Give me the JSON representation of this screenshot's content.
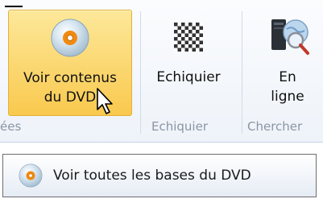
{
  "ribbon": {
    "buttons": [
      {
        "line1": "Voir contenus",
        "line2": "du DVD",
        "icon": "dvd-disc-icon",
        "state": "hovered"
      },
      {
        "line1": "Echiquier",
        "line2": "",
        "icon": "chessboard-icon"
      },
      {
        "line1": "En",
        "line2": "ligne",
        "icon": "online-search-icon"
      }
    ],
    "groups": {
      "left_partial": "ées",
      "echiquier": "Echiquier",
      "chercher": "Chercher"
    }
  },
  "tooltip": {
    "text": "Voir toutes les bases du DVD",
    "icon": "dvd-disc-icon"
  },
  "colors": {
    "active_button_top": "#fde89a",
    "active_button_bottom": "#f9c94e",
    "group_label": "#8b95a3"
  }
}
